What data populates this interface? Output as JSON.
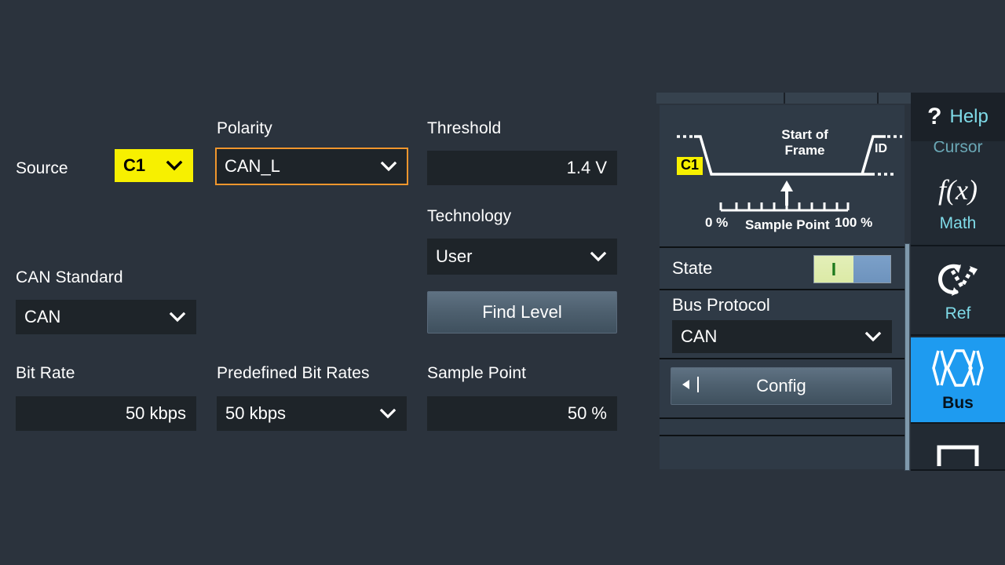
{
  "form": {
    "source": {
      "label": "Source",
      "value": "C1",
      "chevron_icon": "chevron-down-icon"
    },
    "polarity": {
      "label": "Polarity",
      "value": "CAN_L",
      "chevron_icon": "chevron-down-icon",
      "focused": true
    },
    "threshold": {
      "label": "Threshold",
      "value": "1.4 V"
    },
    "can_standard": {
      "label": "CAN Standard",
      "value": "CAN",
      "chevron_icon": "chevron-down-icon"
    },
    "technology": {
      "label": "Technology",
      "value": "User",
      "chevron_icon": "chevron-down-icon"
    },
    "find_level": {
      "label": "Find Level"
    },
    "bit_rate": {
      "label": "Bit Rate",
      "value": "50 kbps"
    },
    "predefined_bit_rates": {
      "label": "Predefined Bit Rates",
      "value": "50 kbps",
      "chevron_icon": "chevron-down-icon"
    },
    "sample_point": {
      "label": "Sample Point",
      "value": "50 %"
    }
  },
  "diagram": {
    "channel_badge": "C1",
    "frame_label_line1": "Start of",
    "frame_label_line2": "Frame",
    "id_label": "ID",
    "scale_min": "0 %",
    "scale_max": "100 %",
    "scale_caption": "Sample Point",
    "tick_count": 9,
    "marker_position_percent": 50
  },
  "side_panel": {
    "state": {
      "label": "State",
      "on_glyph": "I",
      "enabled": true
    },
    "bus_protocol": {
      "label": "Bus Protocol",
      "value": "CAN",
      "chevron_icon": "chevron-down-icon"
    },
    "config": {
      "label": "Config",
      "back_icon": "back-triangle-icon"
    }
  },
  "icon_rail": {
    "help": {
      "label": "Help",
      "icon": "question-mark-icon"
    },
    "ghost_item": {
      "label": "Cursor"
    },
    "items": [
      {
        "label": "Math",
        "icon": "function-fx-icon",
        "active": false
      },
      {
        "label": "Ref",
        "icon": "reference-waveform-icon",
        "active": false
      },
      {
        "label": "Bus",
        "icon": "bus-eye-diagram-icon",
        "active": true
      },
      {
        "label": "",
        "icon": "digital-logic-icon",
        "active": false
      }
    ]
  },
  "colors": {
    "background": "#2b333d",
    "card": "#2f3a46",
    "input": "#1e2429",
    "accent_focus": "#f0962d",
    "channel_yellow": "#f7f000",
    "active_blue": "#1e9bf0",
    "rail_label_cyan": "#7fdbe8",
    "state_on_green": "#dceaa6"
  }
}
